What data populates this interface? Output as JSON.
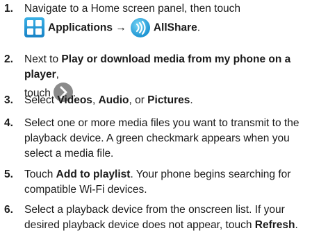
{
  "steps": [
    {
      "num": "1.",
      "text_a": "Navigate to a Home screen panel, then touch",
      "apps": "Applications",
      "arrow": "→",
      "allshare": "AllShare",
      "end": "."
    },
    {
      "num": "2.",
      "pre": "Next to ",
      "bold": "Play or download media from my phone on a player",
      "mid": ",",
      "line2": "touch",
      "end": "."
    },
    {
      "num": "3.",
      "pre": "Select ",
      "b1": "Videos",
      "sep1": ", ",
      "b2": "Audio",
      "sep2": ", or ",
      "b3": "Pictures",
      "end": "."
    },
    {
      "num": "4.",
      "l1": "Select one or more media files you want to transmit to the",
      "l2": "playback device. A green checkmark appears when you",
      "l3": "select a media file."
    },
    {
      "num": "5.",
      "pre": "Touch ",
      "bold": "Add to playlist",
      "post": ". Your phone begins searching for",
      "l2": "compatible Wi-Fi devices."
    },
    {
      "num": "6.",
      "l1": "Select a playback device from the onscreen list. If your",
      "l2pre": "desired playback device does not appear, touch ",
      "bold": "Refresh",
      "end": "."
    }
  ]
}
